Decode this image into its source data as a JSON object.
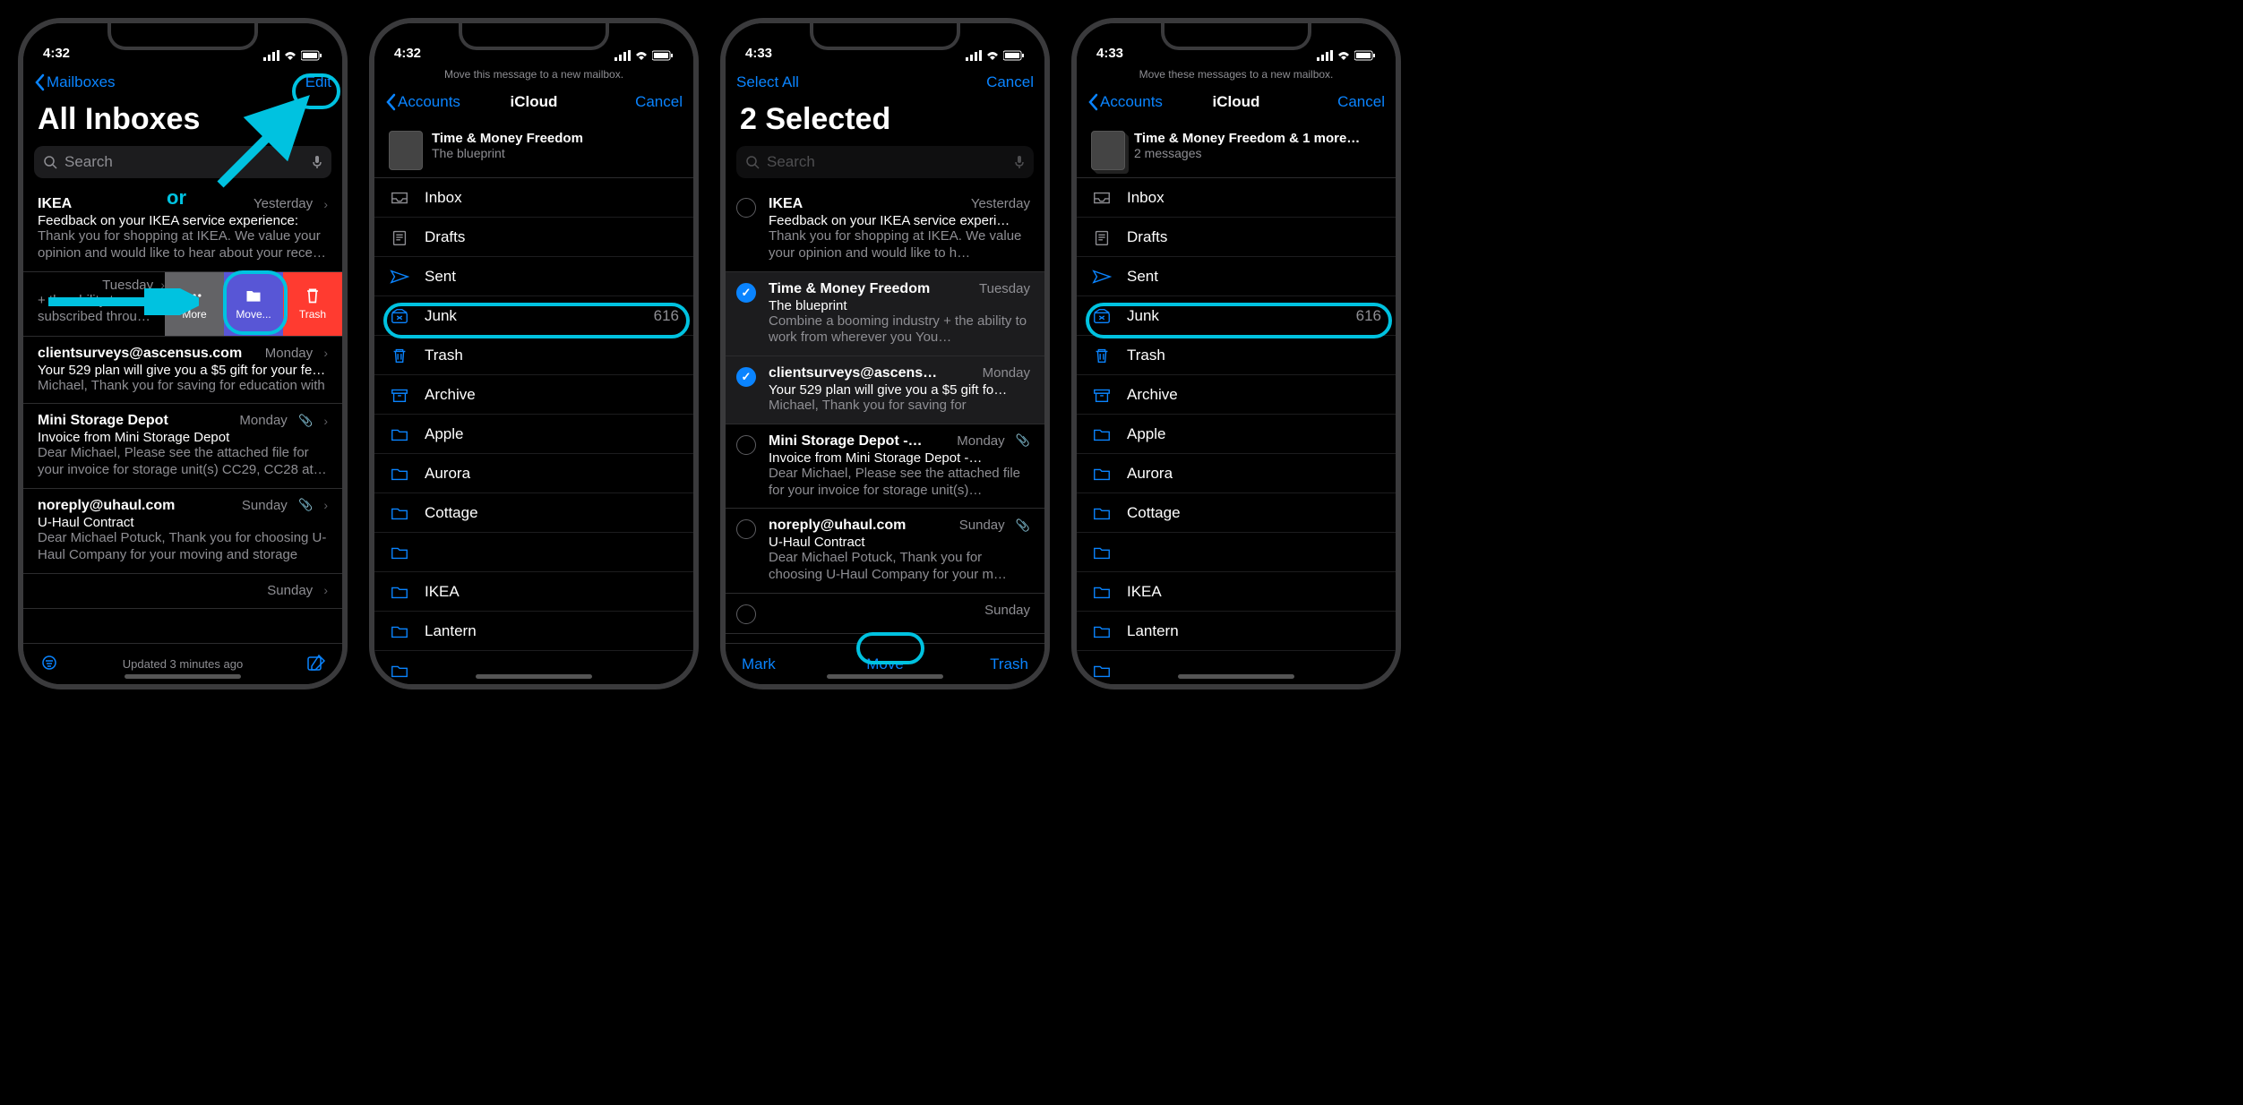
{
  "statusbar": {
    "time1": "4:32",
    "time2": "4:32",
    "time3": "4:33",
    "time4": "4:33"
  },
  "annotations": {
    "or_label": "or"
  },
  "phone1": {
    "back_label": "Mailboxes",
    "edit_label": "Edit",
    "title": "All Inboxes",
    "search_placeholder": "Search",
    "toolbar_status": "Updated 3 minutes ago",
    "rows": [
      {
        "sender": "IKEA",
        "date": "Yesterday",
        "subj": "Feedback on your IKEA service experience:",
        "preview": "Thank you for shopping at IKEA. We value your opinion and would like to hear about your rece…"
      },
      {
        "sender": "",
        "date": "Tuesday",
        "subj": "",
        "preview": "+ the ability to subscribed throu…",
        "swipe_more": "More",
        "swipe_move": "Move...",
        "swipe_trash": "Trash"
      },
      {
        "sender": "clientsurveys@ascensus.com",
        "date": "Monday",
        "subj": "Your 529 plan will give you a $5 gift for your fe…",
        "preview": "Michael, Thank you for saving for education with"
      },
      {
        "sender": "Mini Storage Depot",
        "date": "Monday",
        "subj": "Invoice from Mini Storage Depot",
        "preview": "Dear Michael, Please see the attached file for your invoice for storage unit(s) CC29, CC28 at…",
        "attach": true
      },
      {
        "sender": "noreply@uhaul.com",
        "date": "Sunday",
        "subj": "U-Haul Contract",
        "preview": "Dear Michael Potuck, Thank you for choosing U-Haul Company for your moving and storage ne…",
        "attach": true
      },
      {
        "sender": "",
        "date": "Sunday",
        "subj": "",
        "preview": ""
      }
    ]
  },
  "phone2": {
    "instruction": "Move this message to a new mailbox.",
    "back": "Accounts",
    "title": "iCloud",
    "cancel": "Cancel",
    "msg_title": "Time & Money Freedom",
    "msg_sub": "The blueprint",
    "mailboxes": [
      {
        "icon": "inbox",
        "label": "Inbox",
        "count": ""
      },
      {
        "icon": "drafts",
        "label": "Drafts",
        "count": ""
      },
      {
        "icon": "sent",
        "label": "Sent",
        "count": ""
      },
      {
        "icon": "junk",
        "label": "Junk",
        "count": "616"
      },
      {
        "icon": "trash",
        "label": "Trash",
        "count": ""
      },
      {
        "icon": "archive",
        "label": "Archive",
        "count": ""
      },
      {
        "icon": "folder",
        "label": "Apple",
        "count": ""
      },
      {
        "icon": "folder",
        "label": "Aurora",
        "count": ""
      },
      {
        "icon": "folder",
        "label": "Cottage",
        "count": ""
      },
      {
        "icon": "folder",
        "label": "",
        "count": ""
      },
      {
        "icon": "folder",
        "label": "IKEA",
        "count": ""
      },
      {
        "icon": "folder",
        "label": "Lantern",
        "count": ""
      },
      {
        "icon": "folder",
        "label": "",
        "count": ""
      }
    ]
  },
  "phone3": {
    "select_all": "Select All",
    "cancel": "Cancel",
    "title": "2 Selected",
    "search_placeholder": "Search",
    "toolbar_mark": "Mark",
    "toolbar_move": "Move",
    "toolbar_trash": "Trash",
    "rows": [
      {
        "sel": false,
        "sender": "IKEA",
        "date": "Yesterday",
        "subj": "Feedback on your IKEA service experi…",
        "preview": "Thank you for shopping at IKEA. We value your opinion and would like to h…"
      },
      {
        "sel": true,
        "sender": "Time & Money Freedom",
        "date": "Tuesday",
        "subj": "The blueprint",
        "preview": "Combine a booming industry + the ability to work from wherever you You…"
      },
      {
        "sel": true,
        "sender": "clientsurveys@ascens…",
        "date": "Monday",
        "subj": "Your 529 plan will give you a $5 gift fo…",
        "preview": "Michael, Thank you for saving for"
      },
      {
        "sel": false,
        "sender": "Mini Storage Depot -…",
        "date": "Monday",
        "subj": "Invoice from Mini Storage Depot -…",
        "preview": "Dear Michael, Please see the attached file for your invoice for storage unit(s)…",
        "attach": true
      },
      {
        "sel": false,
        "sender": "noreply@uhaul.com",
        "date": "Sunday",
        "subj": "U-Haul Contract",
        "preview": "Dear Michael Potuck, Thank you for choosing U-Haul Company for your m…",
        "attach": true
      },
      {
        "sel": false,
        "sender": "",
        "date": "Sunday",
        "subj": "",
        "preview": ""
      }
    ]
  },
  "phone4": {
    "instruction": "Move these messages to a new mailbox.",
    "back": "Accounts",
    "title": "iCloud",
    "cancel": "Cancel",
    "msg_title": "Time & Money Freedom & 1 more…",
    "msg_sub": "2 messages",
    "mailboxes": [
      {
        "icon": "inbox",
        "label": "Inbox",
        "count": ""
      },
      {
        "icon": "drafts",
        "label": "Drafts",
        "count": ""
      },
      {
        "icon": "sent",
        "label": "Sent",
        "count": ""
      },
      {
        "icon": "junk",
        "label": "Junk",
        "count": "616"
      },
      {
        "icon": "trash",
        "label": "Trash",
        "count": ""
      },
      {
        "icon": "archive",
        "label": "Archive",
        "count": ""
      },
      {
        "icon": "folder",
        "label": "Apple",
        "count": ""
      },
      {
        "icon": "folder",
        "label": "Aurora",
        "count": ""
      },
      {
        "icon": "folder",
        "label": "Cottage",
        "count": ""
      },
      {
        "icon": "folder",
        "label": "",
        "count": ""
      },
      {
        "icon": "folder",
        "label": "IKEA",
        "count": ""
      },
      {
        "icon": "folder",
        "label": "Lantern",
        "count": ""
      },
      {
        "icon": "folder",
        "label": "",
        "count": ""
      }
    ]
  }
}
